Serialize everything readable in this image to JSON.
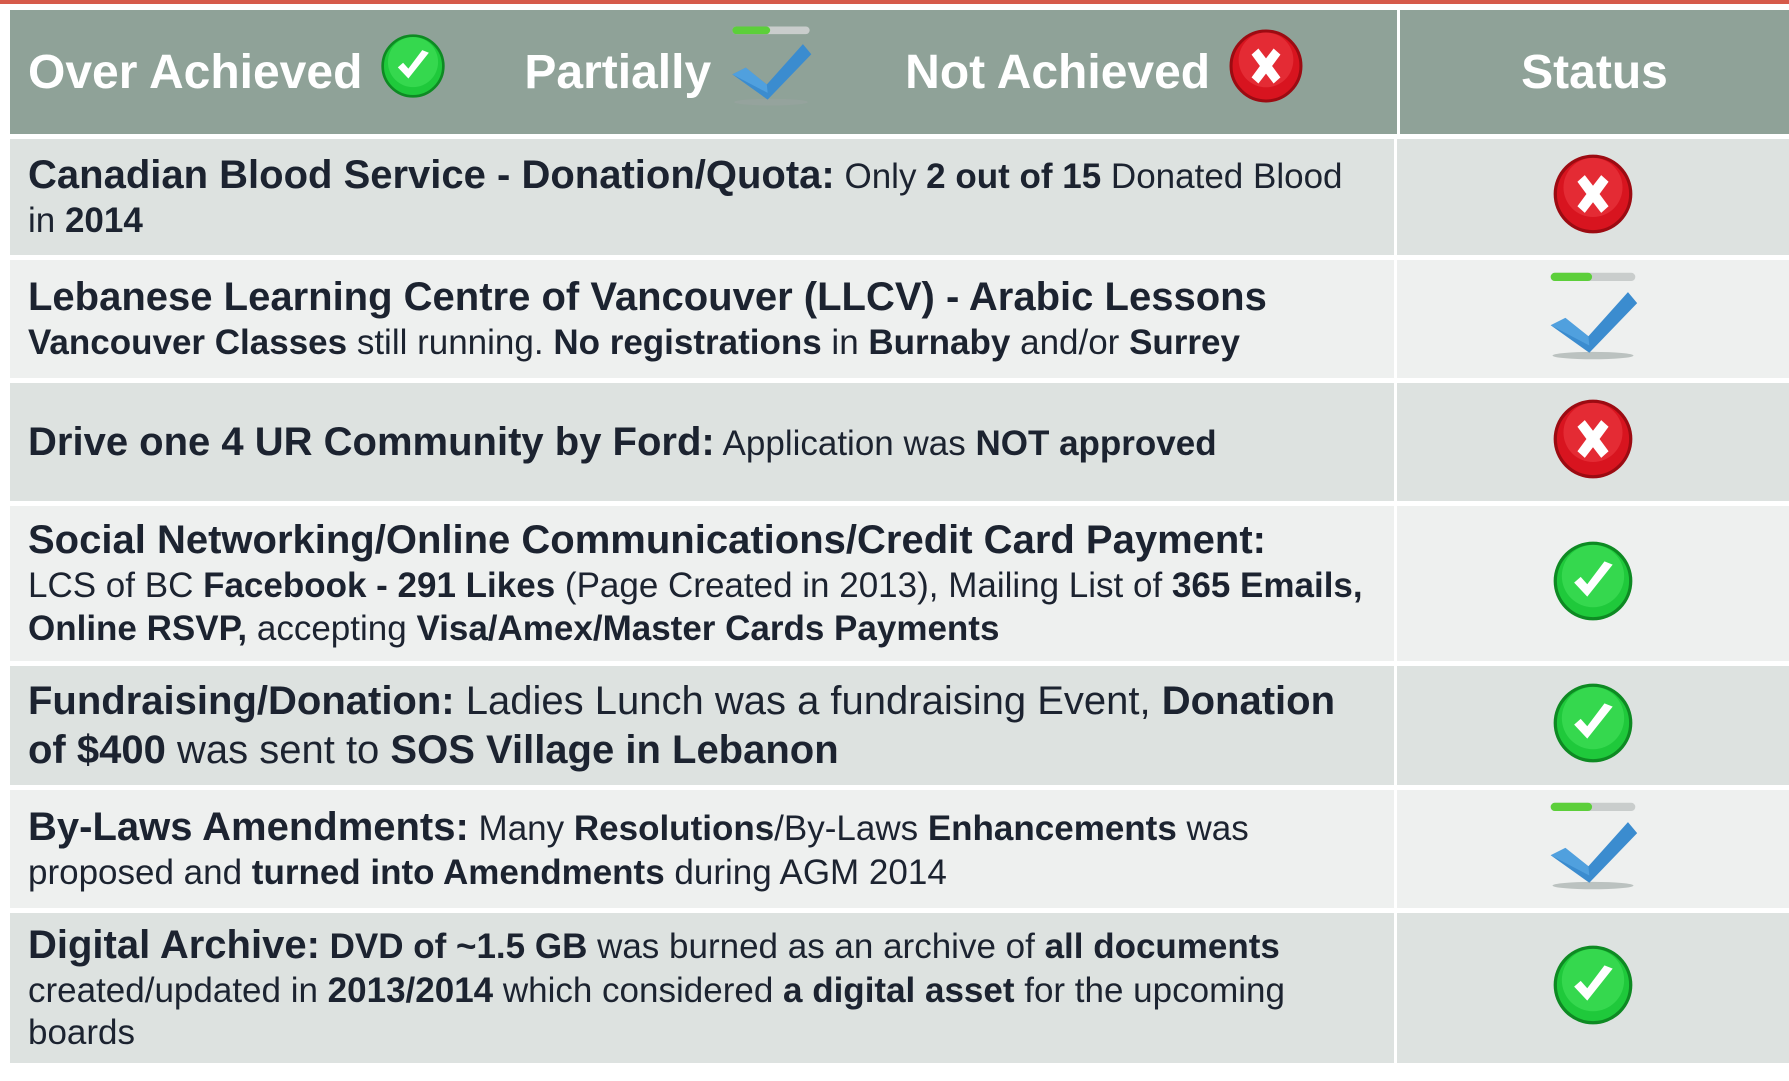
{
  "header": {
    "legend": {
      "over_achieved": "Over Achieved",
      "partially": "Partially",
      "not_achieved": "Not Achieved"
    },
    "status_label": "Status"
  },
  "icons": {
    "over": "green-check-icon",
    "partial": "blue-check-progress-icon",
    "not": "red-x-icon"
  },
  "colors": {
    "header_bg": "#8fa298",
    "row_dark": "#dde2e0",
    "row_light": "#eef0ef",
    "accent_red": "#e5202e",
    "accent_green": "#2fd84c",
    "accent_blue": "#3d8fd0"
  },
  "rows": [
    {
      "status": "not",
      "segments": [
        {
          "t": "Canadian Blood Service - Donation/Quota:",
          "s": "title"
        },
        {
          "t": " Only ",
          "s": "body"
        },
        {
          "t": "2 out of 15",
          "s": "body b"
        },
        {
          "t": " Donated Blood in ",
          "s": "body"
        },
        {
          "t": "2014",
          "s": "body b"
        }
      ]
    },
    {
      "status": "partial",
      "segments": [
        {
          "t": "Lebanese Learning Centre of Vancouver (LLCV) - Arabic Lessons",
          "s": "title",
          "br": true
        },
        {
          "t": "Vancouver Classes",
          "s": "body b"
        },
        {
          "t": " still running. ",
          "s": "body"
        },
        {
          "t": "No registrations",
          "s": "body b"
        },
        {
          "t": " in ",
          "s": "body"
        },
        {
          "t": "Burnaby",
          "s": "body b"
        },
        {
          "t": " and/or ",
          "s": "body"
        },
        {
          "t": "Surrey",
          "s": "body b"
        }
      ]
    },
    {
      "status": "not",
      "segments": [
        {
          "t": "Drive one 4 UR Community by Ford:",
          "s": "title"
        },
        {
          "t": " Application was ",
          "s": "body"
        },
        {
          "t": "NOT approved",
          "s": "body b"
        }
      ]
    },
    {
      "status": "over",
      "segments": [
        {
          "t": "Social Networking/Online Communications/Credit Card Payment:",
          "s": "title",
          "br": true
        },
        {
          "t": "LCS of BC ",
          "s": "body"
        },
        {
          "t": "Facebook - 291 Likes",
          "s": "body b"
        },
        {
          "t": " (Page Created in 2013), Mailing List of ",
          "s": "body"
        },
        {
          "t": "365 Emails, Online RSVP,",
          "s": "body b"
        },
        {
          "t": " accepting ",
          "s": "body"
        },
        {
          "t": "Visa/Amex/Master Cards Payments",
          "s": "body b"
        }
      ]
    },
    {
      "status": "over",
      "segments": [
        {
          "t": "Fundraising/Donation:",
          "s": "title"
        },
        {
          "t": " Ladies Lunch was a fundraising Event, ",
          "s": "body-big"
        },
        {
          "t": "Donation of $400",
          "s": "body-big b"
        },
        {
          "t": " was sent to ",
          "s": "body-big"
        },
        {
          "t": "SOS Village in Lebanon",
          "s": "body-big b"
        }
      ]
    },
    {
      "status": "partial",
      "segments": [
        {
          "t": "By-Laws Amendments:",
          "s": "title"
        },
        {
          "t": " Many ",
          "s": "body"
        },
        {
          "t": "Resolutions",
          "s": "body b"
        },
        {
          "t": "/By-Laws ",
          "s": "body"
        },
        {
          "t": "Enhancements",
          "s": "body b"
        },
        {
          "t": " was proposed and ",
          "s": "body"
        },
        {
          "t": "turned into Amendments",
          "s": "body b"
        },
        {
          "t": " during AGM 2014",
          "s": "body"
        }
      ]
    },
    {
      "status": "over",
      "segments": [
        {
          "t": "Digital Archive:",
          "s": "title"
        },
        {
          "t": " DVD of ~1.5 GB",
          "s": "body b"
        },
        {
          "t": " was burned as an archive of ",
          "s": "body"
        },
        {
          "t": "all documents",
          "s": "body b"
        },
        {
          "t": " created/updated in ",
          "s": "body"
        },
        {
          "t": "2013/2014",
          "s": "body b"
        },
        {
          "t": " which considered ",
          "s": "body"
        },
        {
          "t": "a digital asset",
          "s": "body b"
        },
        {
          "t": " for the upcoming boards",
          "s": "body"
        }
      ]
    }
  ]
}
